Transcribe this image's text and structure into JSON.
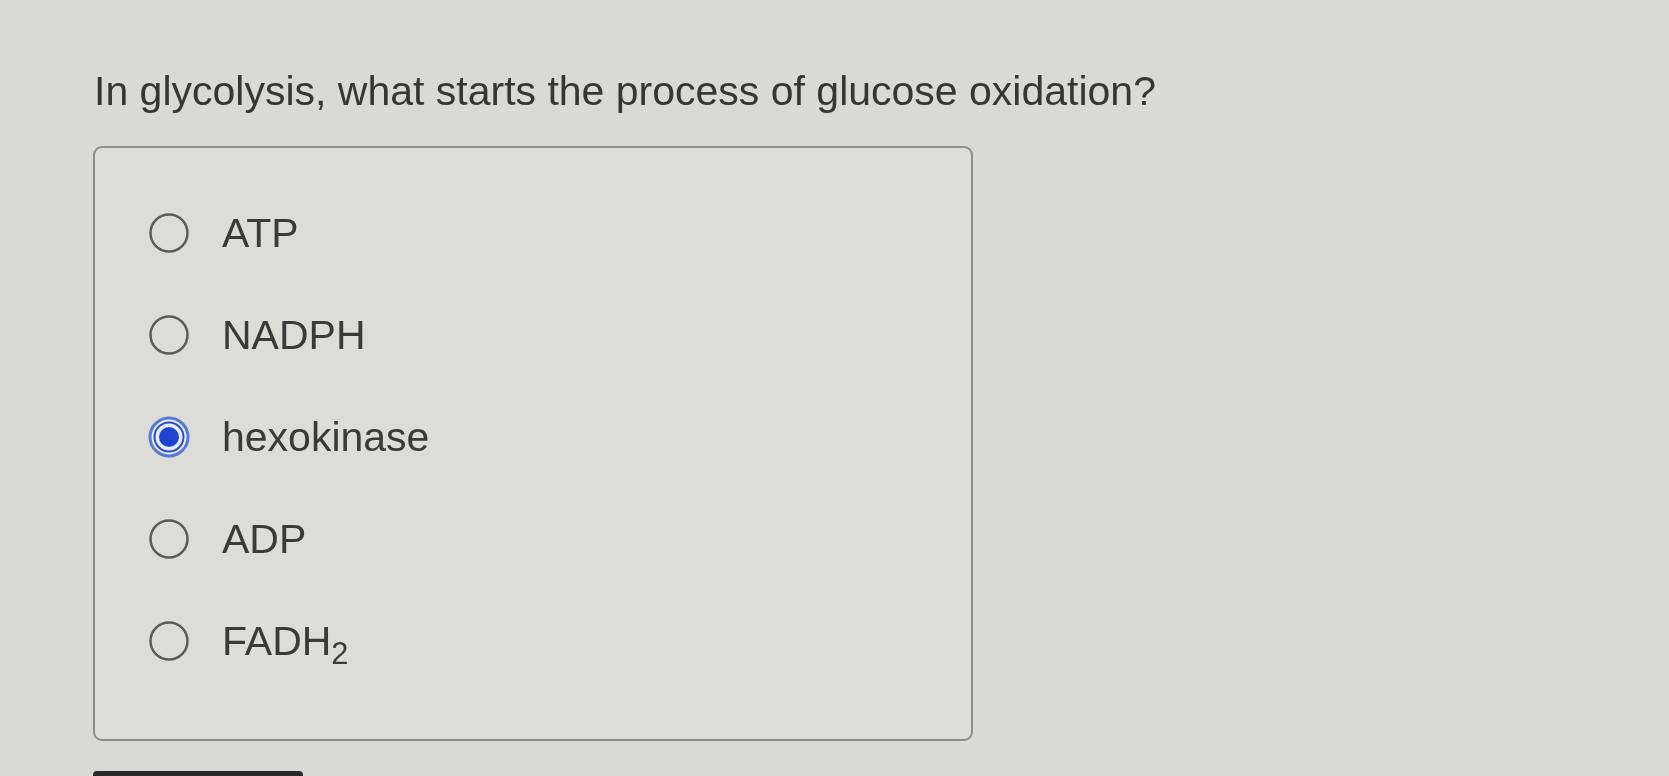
{
  "question": "In glycolysis, what starts the process of glucose oxidation?",
  "options": [
    {
      "label": "ATP",
      "selected": false
    },
    {
      "label": "NADPH",
      "selected": false
    },
    {
      "label": "hexokinase",
      "selected": true
    },
    {
      "label": "ADP",
      "selected": false
    },
    {
      "label": "FADH$_{2}$",
      "selected": false
    }
  ]
}
